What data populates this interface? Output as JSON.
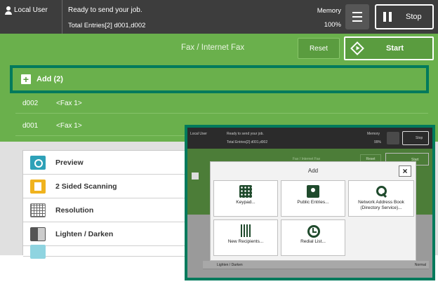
{
  "header": {
    "user_label": "Local User",
    "status_message": "Ready to send your job.",
    "total_entries": "Total Entries[2]  d001,d002",
    "memory_label": "Memory",
    "memory_value": "100%",
    "stop_label": "Stop"
  },
  "title_bar": {
    "title": "Fax / Internet Fax",
    "reset_label": "Reset",
    "start_label": "Start"
  },
  "recipients": {
    "add_label": "Add (2)",
    "rows": [
      {
        "code": "d002",
        "name": "<Fax 1>"
      },
      {
        "code": "d001",
        "name": "<Fax 1>"
      }
    ]
  },
  "features": [
    {
      "label": "Preview",
      "icon": "preview-icon"
    },
    {
      "label": "2 Sided Scanning",
      "icon": "two-sided-icon"
    },
    {
      "label": "Resolution",
      "icon": "resolution-icon"
    },
    {
      "label": "Lighten / Darken",
      "icon": "lighten-darken-icon"
    }
  ],
  "inset": {
    "header": {
      "user_label": "Local User",
      "status_message": "Ready to send your job.",
      "total_entries": "Total Entries[2]  d001,d002",
      "memory_label": "Memory",
      "memory_value": "99%",
      "stop_label": "Stop"
    },
    "title": "Fax / Internet Fax",
    "reset_label": "Reset",
    "start_label": "Start",
    "feature_label": "Lighten / Darken",
    "feature_value": "Normal",
    "dialog": {
      "title": "Add",
      "close_symbol": "×",
      "options": [
        {
          "label": "Keypad...",
          "icon": "keypad-icon"
        },
        {
          "label": "Public Entries...",
          "icon": "address-book-icon"
        },
        {
          "label": "Network Address Book (Directory Service)...",
          "icon": "search-icon"
        },
        {
          "label": "New Recipients...",
          "icon": "keyboard-icon"
        },
        {
          "label": "Redial List...",
          "icon": "redial-icon"
        }
      ]
    }
  },
  "colors": {
    "header_bg": "#3d3d3d",
    "primary_green": "#6ab04c",
    "highlight_teal": "#007a5c",
    "feature_bg": "#e0e0e0"
  }
}
